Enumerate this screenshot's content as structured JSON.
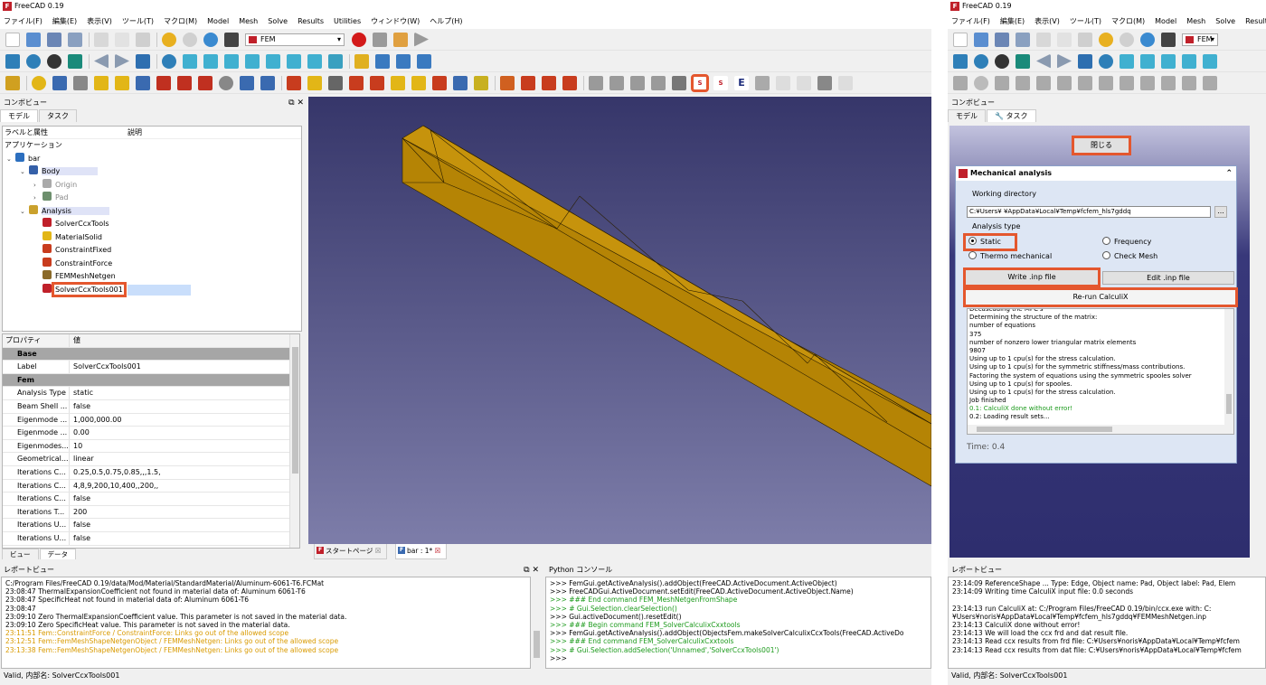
{
  "left": {
    "title": "FreeCAD 0.19",
    "menu": [
      "ファイル(F)",
      "編集(E)",
      "表示(V)",
      "ツール(T)",
      "マクロ(M)",
      "Model",
      "Mesh",
      "Solve",
      "Results",
      "Utilities",
      "ウィンドウ(W)",
      "ヘルプ(H)"
    ],
    "workbench": "FEM",
    "combo_title": "コンボビュー",
    "tabs": [
      "モデル",
      "タスク"
    ],
    "tree_headers": [
      "ラベルと属性",
      "説明"
    ],
    "tree_root": "アプリケーション",
    "tree": [
      {
        "label": "bar",
        "indent": 0,
        "arrow": "v",
        "color": "#2c6fbf"
      },
      {
        "label": "Body",
        "indent": 1,
        "arrow": "v",
        "color": "#3560a8"
      },
      {
        "label": "Origin",
        "indent": 2,
        "arrow": ">",
        "color": "#aaaaaa"
      },
      {
        "label": "Pad",
        "indent": 2,
        "arrow": ">",
        "color": "#6d8f6d"
      },
      {
        "label": "Analysis",
        "indent": 1,
        "arrow": "v",
        "color": "#caa12d"
      },
      {
        "label": "SolverCcxTools",
        "indent": 2,
        "arrow": "",
        "color": "#c0202a"
      },
      {
        "label": "MaterialSolid",
        "indent": 2,
        "arrow": "",
        "color": "#e2b617"
      },
      {
        "label": "ConstraintFixed",
        "indent": 2,
        "arrow": "",
        "color": "#c83c1e"
      },
      {
        "label": "ConstraintForce",
        "indent": 2,
        "arrow": "",
        "color": "#c83c1e"
      },
      {
        "label": "FEMMeshNetgen",
        "indent": 2,
        "arrow": "",
        "color": "#8a6a2a"
      },
      {
        "label": "SolverCcxTools001",
        "indent": 2,
        "arrow": "",
        "color": "#c0202a"
      }
    ],
    "prop_headers": [
      "プロパティ",
      "値"
    ],
    "props": [
      {
        "k": "Base",
        "v": "",
        "group": true
      },
      {
        "k": "Label",
        "v": "SolverCcxTools001"
      },
      {
        "k": "Fem",
        "v": "",
        "group": true
      },
      {
        "k": "Analysis Type",
        "v": "static"
      },
      {
        "k": "Beam Shell ...",
        "v": "false"
      },
      {
        "k": "Eigenmode ...",
        "v": "1,000,000.00"
      },
      {
        "k": "Eigenmode ...",
        "v": "0.00"
      },
      {
        "k": "Eigenmodes...",
        "v": "10"
      },
      {
        "k": "Geometrical...",
        "v": "linear"
      },
      {
        "k": "Iterations C...",
        "v": "0.25,0.5,0.75,0.85,,,1.5,"
      },
      {
        "k": "Iterations C...",
        "v": "4,8,9,200,10,400,,200,,"
      },
      {
        "k": "Iterations C...",
        "v": "false"
      },
      {
        "k": "Iterations T...",
        "v": "200"
      },
      {
        "k": "Iterations U...",
        "v": "false"
      },
      {
        "k": "Iterations U...",
        "v": "false"
      }
    ],
    "bottom_tabs": [
      "ビュー",
      "データ"
    ],
    "doc_tabs": [
      "スタートページ",
      "bar : 1*"
    ],
    "report_title": "レポートビュー",
    "python_title": "Python コンソール",
    "report": [
      {
        "t": "   C:/Program Files/FreeCAD 0.19/data/Mod/Material/StandardMaterial/Aluminum-6061-T6.FCMat",
        "c": "#000"
      },
      {
        "t": "23:08:47  ThermalExpansionCoefficient not found in material data of: Aluminum 6061-T6",
        "c": "#000"
      },
      {
        "t": "23:08:47  SpecificHeat not found in material data of: Aluminum 6061-T6",
        "c": "#000"
      },
      {
        "t": "23:08:47",
        "c": "#000"
      },
      {
        "t": "23:09:10  Zero ThermalExpansionCoefficient value. This parameter is not saved in the material data.",
        "c": "#000"
      },
      {
        "t": "23:09:10  Zero SpecificHeat value. This parameter is not saved in the material data.",
        "c": "#000"
      },
      {
        "t": "23:11:51  Fem::ConstraintForce / ConstraintForce: Links go out of the allowed scope",
        "c": "#d99a00"
      },
      {
        "t": "23:12:51  Fem::FemMeshShapeNetgenObject / FEMMeshNetgen: Links go out of the allowed scope",
        "c": "#d99a00"
      },
      {
        "t": "23:13:38  Fem::FemMeshShapeNetgenObject / FEMMeshNetgen: Links go out of the allowed scope",
        "c": "#d99a00"
      }
    ],
    "python": [
      {
        "t": ">>> FemGui.getActiveAnalysis().addObject(FreeCAD.ActiveDocument.ActiveObject)",
        "c": "#000"
      },
      {
        "t": ">>> FreeCADGui.ActiveDocument.setEdit(FreeCAD.ActiveDocument.ActiveObject.Name)",
        "c": "#000"
      },
      {
        "t": ">>> ### End command FEM_MeshNetgenFromShape",
        "c": "#1c9a1c"
      },
      {
        "t": ">>> # Gui.Selection.clearSelection()",
        "c": "#1c9a1c"
      },
      {
        "t": ">>> Gui.activeDocument().resetEdit()",
        "c": "#000"
      },
      {
        "t": ">>> ### Begin command FEM_SolverCalculixCxxtools",
        "c": "#1c9a1c"
      },
      {
        "t": ">>> FemGui.getActiveAnalysis().addObject(ObjectsFem.makeSolverCalculixCcxTools(FreeCAD.ActiveDo",
        "c": "#000"
      },
      {
        "t": ">>> ### End command FEM_SolverCalculixCxxtools",
        "c": "#1c9a1c"
      },
      {
        "t": ">>> # Gui.Selection.addSelection('Unnamed','SolverCcxTools001')",
        "c": "#1c9a1c"
      },
      {
        "t": ">>>",
        "c": "#000"
      }
    ],
    "status": "Valid, 内部名: SolverCcxTools001"
  },
  "right": {
    "title": "FreeCAD 0.19",
    "menu": [
      "ファイル(F)",
      "編集(E)",
      "表示(V)",
      "ツール(T)",
      "マクロ(M)",
      "Model",
      "Mesh",
      "Solve",
      "Results"
    ],
    "workbench": "FEM",
    "combo_title": "コンボビュー",
    "tabs": [
      "モデル",
      "タスク"
    ],
    "close_btn": "閉じる",
    "panel_title": "Mechanical analysis",
    "working_dir_label": "Working directory",
    "working_dir": "C:¥Users¥      ¥AppData¥Local¥Temp¥fcfem_hls7gddq",
    "browse": "...",
    "analysis_type_label": "Analysis type",
    "radios": [
      {
        "label": "Static",
        "on": true
      },
      {
        "label": "Frequency",
        "on": false
      },
      {
        "label": "Thermo mechanical",
        "on": false
      },
      {
        "label": "Check Mesh",
        "on": false
      }
    ],
    "write_btn": "Write .inp file",
    "edit_btn": "Edit .inp file",
    "rerun_btn": "Re-run CalculiX",
    "output": [
      {
        "t": "Decascading the MPC's",
        "c": "#000"
      },
      {
        "t": "Determining the structure of the matrix:",
        "c": "#000"
      },
      {
        "t": "number of equations",
        "c": "#000"
      },
      {
        "t": "375",
        "c": "#000"
      },
      {
        "t": "number of nonzero lower triangular matrix elements",
        "c": "#000"
      },
      {
        "t": "9807",
        "c": "#000"
      },
      {
        "t": "Using up to 1 cpu(s) for the stress calculation.",
        "c": "#000"
      },
      {
        "t": "Using up to 1 cpu(s) for the symmetric stiffness/mass contributions.",
        "c": "#000"
      },
      {
        "t": "Factoring the system of equations using the symmetric spooles solver",
        "c": "#000"
      },
      {
        "t": "Using up to 1 cpu(s) for spooles.",
        "c": "#000"
      },
      {
        "t": "Using up to 1 cpu(s) for the stress calculation.",
        "c": "#000"
      },
      {
        "t": "Job finished",
        "c": "#000"
      },
      {
        "t": "0.1: CalculiX done without error!",
        "c": "#1c9a1c"
      },
      {
        "t": "0.2: Loading result sets...",
        "c": "#000"
      }
    ],
    "time": "Time:  0.4",
    "report_title": "レポートビュー",
    "report": [
      {
        "t": "23:14:09       ReferenceShape ... Type: Edge, Object name: Pad, Object label: Pad, Elem"
      },
      {
        "t": "23:14:09  Writing time CalculiX input file: 0.0 seconds"
      },
      {
        "t": ""
      },
      {
        "t": "23:14:13  run CalculiX at: C:/Program Files/FreeCAD 0.19/bin/ccx.exe with: C:"
      },
      {
        "t": "¥Users¥noris¥AppData¥Local¥Temp¥fcfem_hls7gddq¥FEMMeshNetgen.inp"
      },
      {
        "t": "23:14:13  CalculiX done without error!"
      },
      {
        "t": "23:14:13  We will load the ccx frd and dat result file."
      },
      {
        "t": "23:14:13  Read ccx results from frd file: C:¥Users¥noris¥AppData¥Local¥Temp¥fcfem"
      },
      {
        "t": "23:14:13  Read ccx results from dat file: C:¥Users¥noris¥AppData¥Local¥Temp¥fcfem"
      }
    ],
    "status": "Valid, 内部名: SolverCcxTools001"
  },
  "colors": {
    "accent": "#e4572e",
    "viewport_top": "#39396b",
    "viewport_bottom": "#7a7aa6",
    "solid": "#bb8a08",
    "selection": "#c9defb"
  }
}
